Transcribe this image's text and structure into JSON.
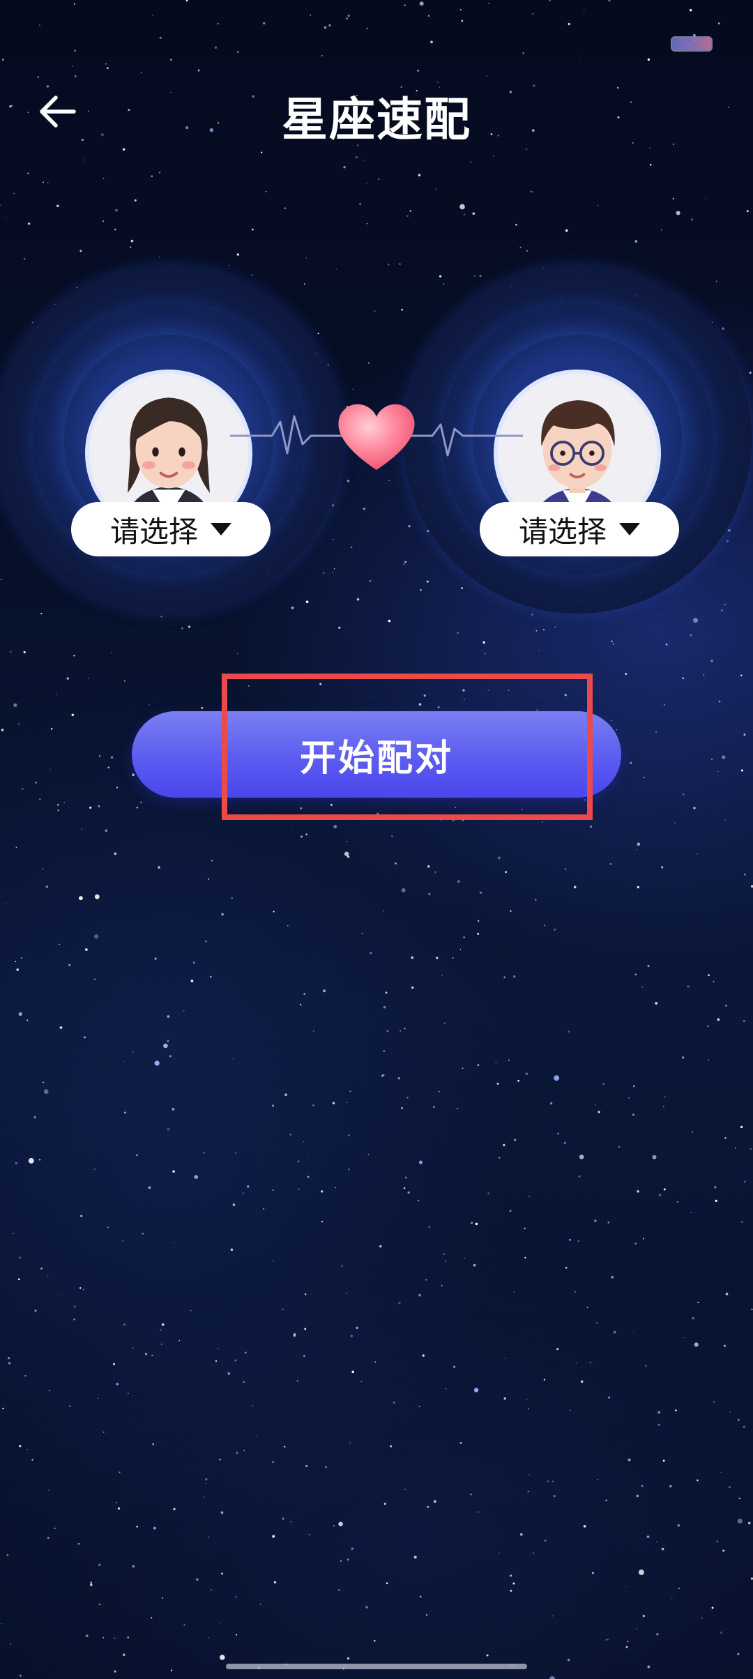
{
  "header": {
    "title": "星座速配",
    "back_icon": "arrow-left-icon"
  },
  "status_bar": {
    "battery_icon": "battery-icon"
  },
  "match": {
    "left": {
      "avatar_icon": "female-avatar-icon",
      "select_label": "请选择"
    },
    "right": {
      "avatar_icon": "male-avatar-icon",
      "select_label": "请选择"
    },
    "heart_icon": "heart-icon",
    "heartbeat_icon": "heartbeat-line-icon"
  },
  "actions": {
    "start_label": "开始配对"
  },
  "colors": {
    "button_gradient_top": "#7b7ff2",
    "button_gradient_bottom": "#4a46ee",
    "highlight_border": "#ea4a4a",
    "heart": "#ff6f88"
  }
}
